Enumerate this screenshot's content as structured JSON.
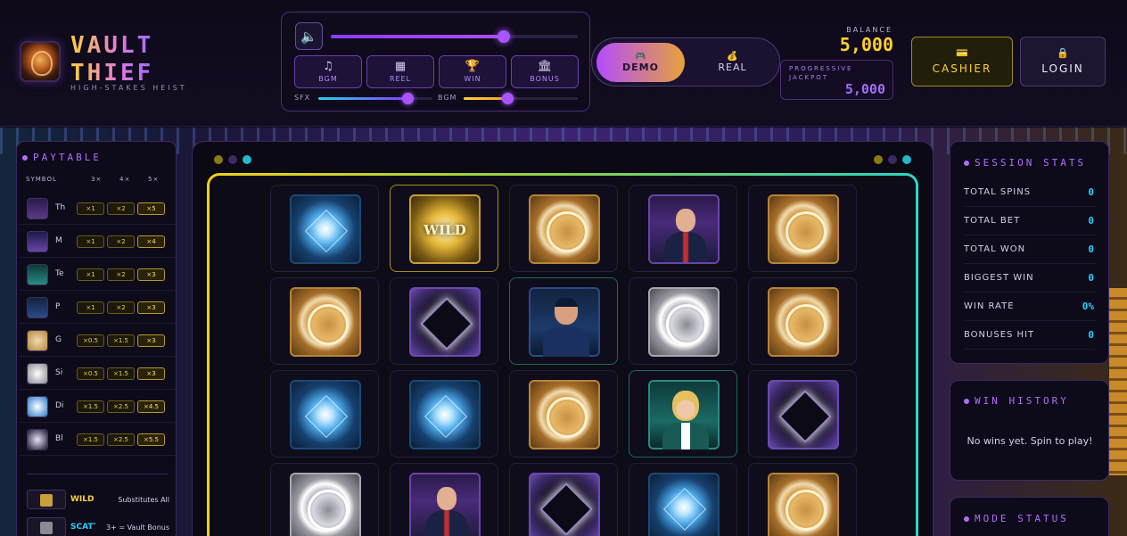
{
  "brand": {
    "title_line1": "VAULT",
    "title_line2": "THIEF",
    "tagline": "HIGH-STAKES HEIST"
  },
  "audio": {
    "speaker_icon": "speaker-icon",
    "master_volume": 0.7,
    "buttons": [
      {
        "label": "BGM",
        "icon": "music-note-icon",
        "glyph": "♫"
      },
      {
        "label": "REEL",
        "icon": "slot-machine-icon",
        "glyph": "▦"
      },
      {
        "label": "WIN",
        "icon": "trophy-icon",
        "glyph": "🏆"
      },
      {
        "label": "BONUS",
        "icon": "vault-icon",
        "glyph": "🏛"
      }
    ],
    "sfx_label": "SFX",
    "sfx_volume": 0.78,
    "bgm_label": "BGM",
    "bgm_volume": 0.38
  },
  "mode": {
    "demo_label": "DEMO",
    "demo_icon": "controller-icon",
    "real_label": "REAL",
    "real_icon": "money-bag-icon",
    "selected": "DEMO"
  },
  "balance": {
    "label": "BALANCE",
    "value": "5,000"
  },
  "jackpot": {
    "label": "PROGRESSIVE JACKPOT",
    "value": "5,000"
  },
  "actions": {
    "cashier_label": "CASHIER",
    "cashier_icon": "card-icon",
    "login_label": "LOGIN",
    "login_icon": "lock-icon"
  },
  "paytable": {
    "title": "PAYTABLE",
    "headers": [
      "SYMBOL",
      "3×",
      "4×",
      "5×"
    ],
    "rows": [
      {
        "name": "Th",
        "icon": "thief-icon",
        "m3": "×1",
        "m4": "×2",
        "m5": "×5"
      },
      {
        "name": "M",
        "icon": "mastermind-icon",
        "m3": "×1",
        "m4": "×2",
        "m5": "×4"
      },
      {
        "name": "Te",
        "icon": "teller-icon",
        "m3": "×1",
        "m4": "×2",
        "m5": "×3"
      },
      {
        "name": "P",
        "icon": "police-icon",
        "m3": "×1",
        "m4": "×2",
        "m5": "×3"
      },
      {
        "name": "G",
        "icon": "gold-coin-icon",
        "m3": "×0.5",
        "m4": "×1.5",
        "m5": "×3"
      },
      {
        "name": "Si",
        "icon": "silver-coin-icon",
        "m3": "×0.5",
        "m4": "×1.5",
        "m5": "×3"
      },
      {
        "name": "Di",
        "icon": "diamond-icon",
        "m3": "×1.5",
        "m4": "×2.5",
        "m5": "×4.5"
      },
      {
        "name": "Bl",
        "icon": "black-diamond-icon",
        "m3": "×1.5",
        "m4": "×2.5",
        "m5": "×5.5"
      }
    ],
    "specials": [
      {
        "name": "WILD",
        "desc": "Substitutes All",
        "icon": "wild-icon",
        "color": "#ffd23a"
      },
      {
        "name": "SCATT",
        "desc": "3+ = Vault Bonus",
        "icon": "scatter-icon",
        "color": "#2ad0ff"
      }
    ]
  },
  "reels": [
    [
      "diamond",
      "gold",
      "diamond",
      "silver"
    ],
    [
      "wild",
      "black",
      "diamond",
      "thief"
    ],
    [
      "gold",
      "police",
      "gold",
      "black"
    ],
    [
      "thief",
      "silver",
      "teller",
      "diamond"
    ],
    [
      "gold",
      "gold",
      "black",
      "gold"
    ]
  ],
  "wild_text": "WILD",
  "stats": {
    "title": "SESSION STATS",
    "rows": [
      {
        "label": "TOTAL SPINS",
        "value": "0"
      },
      {
        "label": "TOTAL BET",
        "value": "0"
      },
      {
        "label": "TOTAL WON",
        "value": "0"
      },
      {
        "label": "BIGGEST WIN",
        "value": "0"
      },
      {
        "label": "WIN RATE",
        "value": "0%"
      },
      {
        "label": "BONUSES HIT",
        "value": "0"
      }
    ]
  },
  "win_history": {
    "title": "WIN HISTORY",
    "empty_text": "No wins yet. Spin to play!"
  },
  "mode_status": {
    "title": "MODE STATUS"
  },
  "colors": {
    "accent_purple": "#b46cff",
    "gold": "#ffd02a",
    "cyan": "#2ad0ff"
  }
}
